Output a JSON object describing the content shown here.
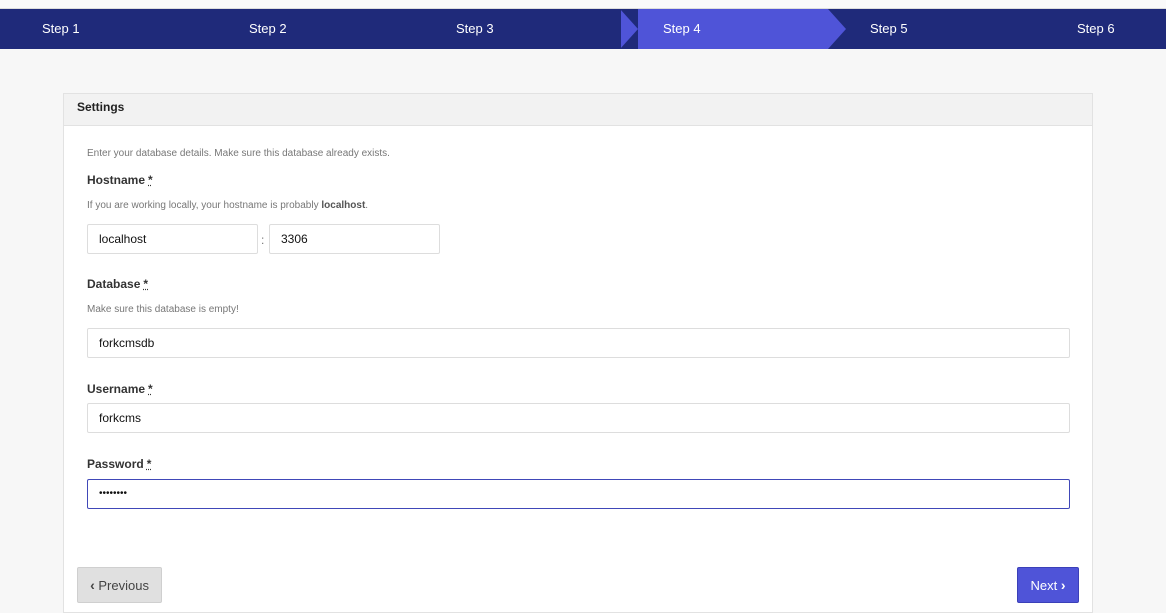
{
  "steps": [
    {
      "label": "Step 1"
    },
    {
      "label": "Step 2"
    },
    {
      "label": "Step 3"
    },
    {
      "label": "Step 4"
    },
    {
      "label": "Step 5"
    },
    {
      "label": "Step 6"
    }
  ],
  "active_step": "Step 4",
  "panel": {
    "title": "Settings",
    "intro": "Enter your database details. Make sure this database already exists."
  },
  "hostname": {
    "label": "Hostname",
    "required_mark": "*",
    "help_prefix": "If you are working locally, your hostname is probably ",
    "help_bold": "localhost",
    "help_suffix": ".",
    "value": "localhost",
    "separator": ":",
    "port_value": "3306"
  },
  "database": {
    "label": "Database",
    "required_mark": "*",
    "help": "Make sure this database is empty!",
    "value": "forkcmsdb"
  },
  "username": {
    "label": "Username",
    "required_mark": "*",
    "value": "forkcms"
  },
  "password": {
    "label": "Password",
    "required_mark": "*",
    "value": "••••••••"
  },
  "buttons": {
    "previous": "Previous",
    "next": "Next",
    "previous_icon": "chevron-left-icon",
    "next_icon": "chevron-right-icon"
  },
  "colors": {
    "nav_bg": "#1f2a7a",
    "accent": "#4f54d8"
  }
}
